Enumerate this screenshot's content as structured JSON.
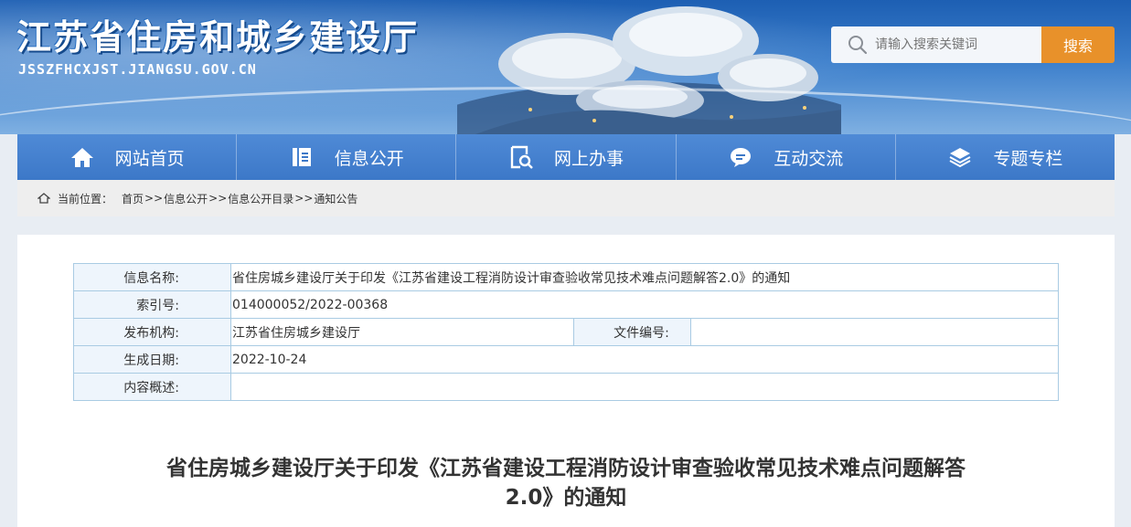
{
  "header": {
    "site_title": "江苏省住房和城乡建设厅",
    "site_url": "JSSZFHCXJST.JIANGSU.GOV.CN",
    "search_placeholder": "请输入搜索关键词",
    "search_button": "搜索",
    "colors": {
      "banner": "#1d5fb3",
      "search_button": "#e8912a"
    }
  },
  "nav": {
    "items": [
      {
        "label": "网站首页",
        "icon": "home-icon"
      },
      {
        "label": "信息公开",
        "icon": "list-icon"
      },
      {
        "label": "网上办事",
        "icon": "document-search-icon"
      },
      {
        "label": "互动交流",
        "icon": "chat-icon"
      },
      {
        "label": "专题专栏",
        "icon": "layers-icon"
      }
    ]
  },
  "breadcrumb": {
    "label": "当前位置：",
    "items": [
      "首页",
      "信息公开",
      "信息公开目录",
      "通知公告"
    ],
    "separator": ">>"
  },
  "info": {
    "name_label": "信息名称:",
    "name_value": "省住房城乡建设厅关于印发《江苏省建设工程消防设计审查验收常见技术难点问题解答2.0》的通知",
    "index_label": "索引号:",
    "index_value": "014000052/2022-00368",
    "publisher_label": "发布机构:",
    "publisher_value": "江苏省住房城乡建设厅",
    "doc_no_label": "文件编号:",
    "doc_no_value": "",
    "date_label": "生成日期:",
    "date_value": "2022-10-24",
    "summary_label": "内容概述:",
    "summary_value": ""
  },
  "article": {
    "title_line1": "省住房城乡建设厅关于印发《江苏省建设工程消防设计审查验收常见技术难点问题解答",
    "title_line2": "2.0》的通知"
  }
}
